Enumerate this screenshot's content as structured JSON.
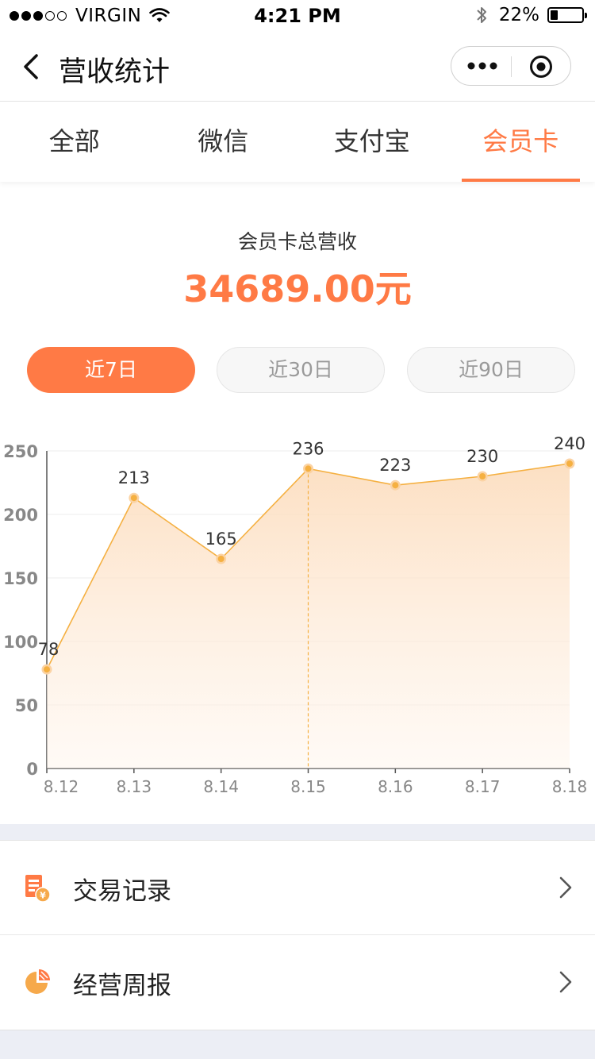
{
  "status_bar": {
    "carrier": "VIRGIN",
    "time": "4:21 PM",
    "battery": "22%"
  },
  "nav": {
    "title": "营收统计"
  },
  "tabs": [
    {
      "label": "全部",
      "active": false
    },
    {
      "label": "微信",
      "active": false
    },
    {
      "label": "支付宝",
      "active": false
    },
    {
      "label": "会员卡",
      "active": true
    }
  ],
  "summary": {
    "label": "会员卡总营收",
    "value": "34689.00元"
  },
  "ranges": [
    {
      "label": "近7日",
      "active": true
    },
    {
      "label": "近30日",
      "active": false
    },
    {
      "label": "近90日",
      "active": false
    }
  ],
  "colors": {
    "accent": "#ff7a45",
    "line": "#f5b041",
    "fill": "#fde3c8"
  },
  "chart_data": {
    "type": "area",
    "categories": [
      "8.12",
      "8.13",
      "8.14",
      "8.15",
      "8.16",
      "8.17",
      "8.18"
    ],
    "series": [
      {
        "values": [
          78,
          213,
          165,
          236,
          223,
          230,
          240
        ]
      }
    ],
    "point_labels": [
      "78",
      "213",
      "165",
      "236",
      "223",
      "230",
      "240"
    ],
    "yticks": [
      "0",
      "50",
      "100",
      "150",
      "200",
      "250"
    ],
    "ylim": [
      0,
      250
    ],
    "grid": true,
    "highlight_index": 3
  },
  "list": [
    {
      "label": "交易记录",
      "icon": "receipt-icon"
    },
    {
      "label": "经营周报",
      "icon": "pie-chart-icon"
    }
  ]
}
